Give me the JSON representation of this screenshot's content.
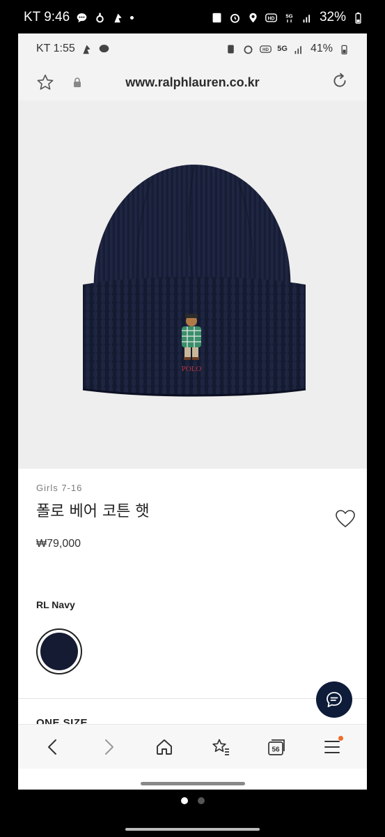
{
  "outer_status": {
    "carrier_time": "KT 9:46",
    "battery": "32%"
  },
  "inner_status": {
    "carrier_time": "KT 1:55",
    "network": "5G",
    "battery": "41%"
  },
  "browser": {
    "url": "www.ralphlauren.co.kr"
  },
  "product": {
    "category": "Girls 7-16",
    "title": "폴로 베어 코튼 햇",
    "price": "₩79,000",
    "color_name": "RL Navy",
    "size_label": "ONE SIZE",
    "logo_text": "POLO"
  },
  "nav": {
    "tabs_count": "56"
  },
  "colors": {
    "navy": "#151b33",
    "fab": "#0e1c3a",
    "badge": "#f06a2a"
  },
  "icons": [
    "close-icon",
    "star-icon",
    "lock-icon",
    "reload-icon",
    "heart-icon",
    "chat-icon",
    "back-icon",
    "forward-icon",
    "home-icon",
    "bookmarks-icon",
    "tabs-icon",
    "menu-icon"
  ]
}
